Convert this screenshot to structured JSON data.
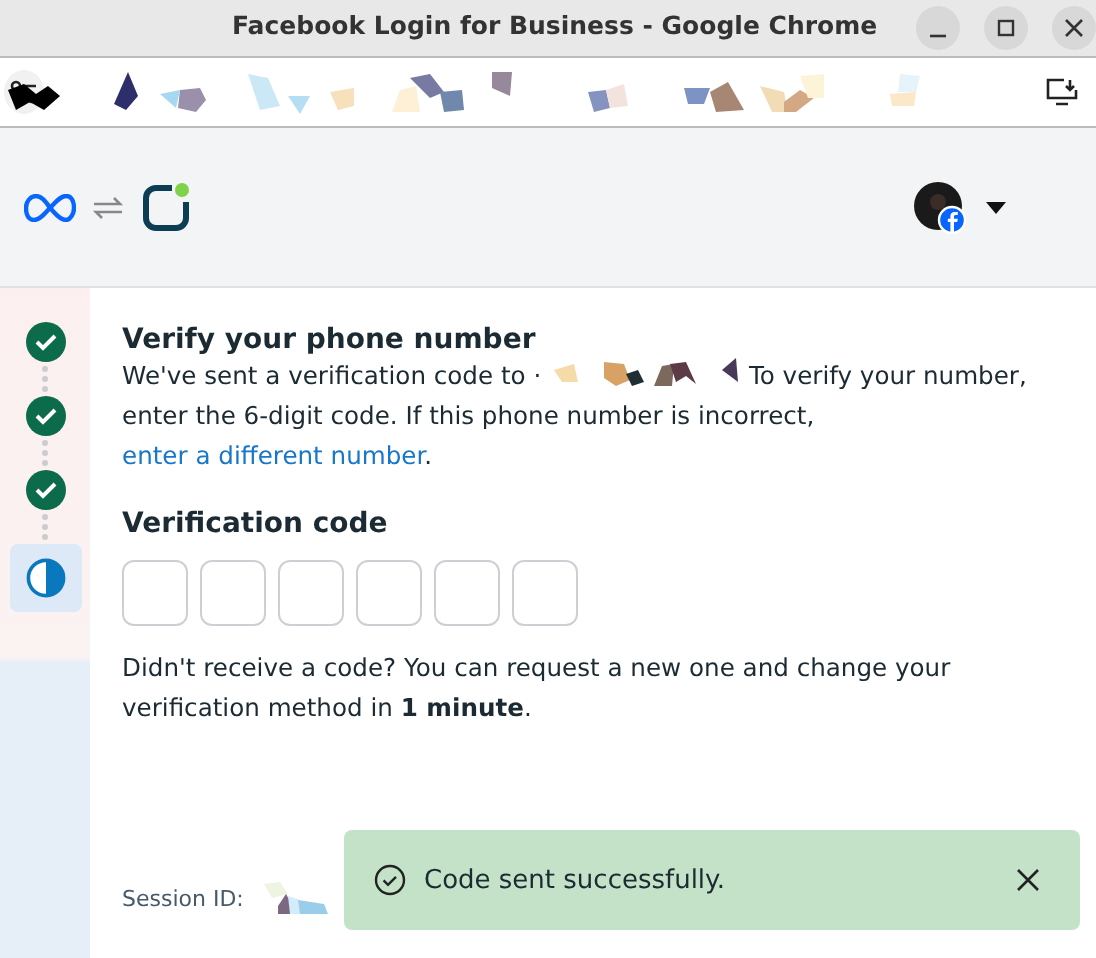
{
  "window": {
    "title": "Facebook Login for Business - Google Chrome"
  },
  "steps": [
    {
      "done": true,
      "selected": false
    },
    {
      "done": true,
      "selected": false
    },
    {
      "done": true,
      "selected": false
    },
    {
      "done": false,
      "selected": true
    }
  ],
  "verify": {
    "heading": "Verify your phone number",
    "message_start": "We've sent a verification code to ·",
    "message_end": "To verify your number, enter the 6-digit code. If this phone number is incorrect,",
    "link": "enter a different number",
    "link_end": "."
  },
  "code": {
    "label": "Verification code"
  },
  "resend": "Didn't receive a code? You can request a new one and change your verification method in **1 minute**.",
  "session": {
    "label": "Session ID:"
  },
  "toast": {
    "message": "Code sent successfully."
  }
}
